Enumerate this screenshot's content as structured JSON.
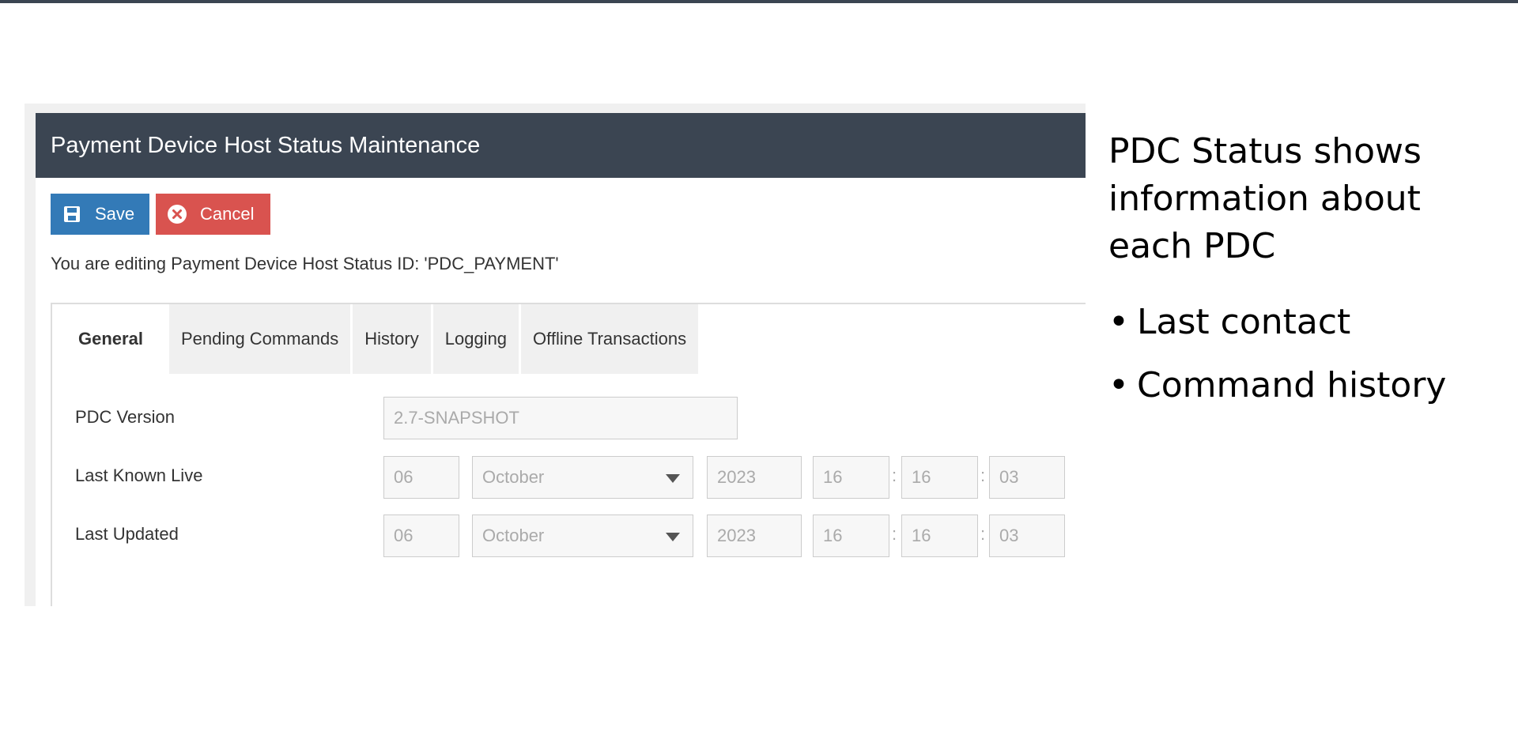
{
  "window": {
    "title": "Payment Device Host Status Maintenance"
  },
  "toolbar": {
    "save_label": "Save",
    "cancel_label": "Cancel",
    "save_icon": "floppy-disk-icon",
    "cancel_icon": "circle-x-icon"
  },
  "editing_message": "You are editing Payment Device Host Status ID: 'PDC_PAYMENT'",
  "tabs": [
    {
      "label": "General",
      "active": true
    },
    {
      "label": "Pending Commands",
      "active": false
    },
    {
      "label": "History",
      "active": false
    },
    {
      "label": "Logging",
      "active": false
    },
    {
      "label": "Offline Transactions",
      "active": false
    }
  ],
  "form": {
    "pdc_version": {
      "label": "PDC Version",
      "value": "2.7-SNAPSHOT"
    },
    "last_known_live": {
      "label": "Last Known Live",
      "day": "06",
      "month": "October",
      "year": "2023",
      "hour": "16",
      "minute": "16",
      "second": "03"
    },
    "last_updated": {
      "label": "Last Updated",
      "day": "06",
      "month": "October",
      "year": "2023",
      "hour": "16",
      "minute": "16",
      "second": "03"
    },
    "time_separator": ":"
  },
  "slide": {
    "heading": "PDC Status shows information about each PDC",
    "bullets": [
      "Last contact",
      "Command history"
    ]
  },
  "colors": {
    "header_bg": "#3b4552",
    "save_bg": "#337ab7",
    "cancel_bg": "#d9534f"
  }
}
